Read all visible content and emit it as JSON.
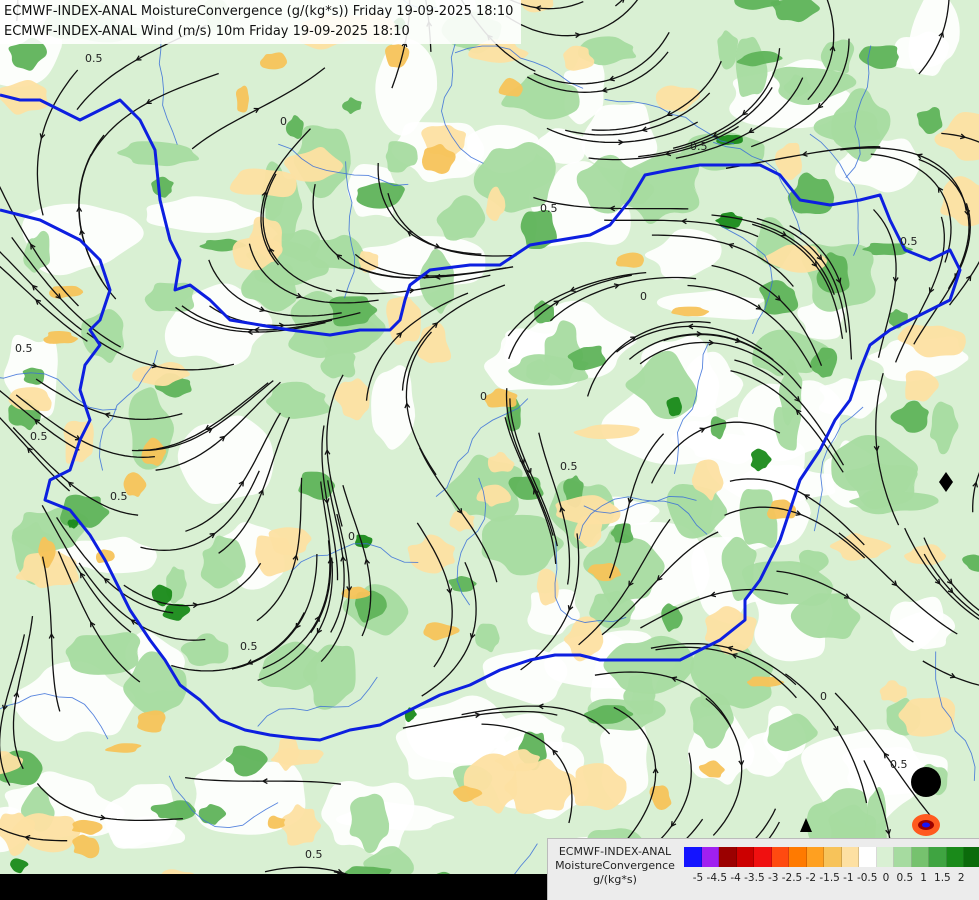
{
  "header": {
    "line1": "ECMWF-INDEX-ANAL MoistureConvergence (g/(kg*s)) Friday 19-09-2025 18:10",
    "line2": "ECMWF-INDEX-ANAL Wind (m/s) 10m Friday 19-09-2025 18:10"
  },
  "map": {
    "contour_labels": [
      "0.5",
      "0",
      "0.5",
      "0",
      "0.5",
      "0.5",
      "0",
      "0.5",
      "0",
      "0.5",
      "0.5",
      "0.5",
      "0",
      "0.5",
      "0.5",
      "0.5"
    ]
  },
  "legend": {
    "title_lines": [
      "ECMWF-INDEX-ANAL",
      "MoistureConvergence",
      "g/(kg*s)"
    ],
    "colors": [
      "#1414ff",
      "#a020f0",
      "#9b0000",
      "#cc0000",
      "#f01010",
      "#ff4a10",
      "#ff7a00",
      "#ffa020",
      "#f7c35a",
      "#fde0a2",
      "#ffffff",
      "#d9f0d3",
      "#a6dba0",
      "#76c26e",
      "#3fa441",
      "#1a8a1a",
      "#0b6b0b"
    ],
    "tick_labels": [
      "-5",
      "-4.5",
      "-4",
      "-3.5",
      "-3",
      "-2.5",
      "-2",
      "-1.5",
      "-1",
      "-0.5",
      "0",
      "0.5",
      "1",
      "1.5",
      "2"
    ]
  }
}
